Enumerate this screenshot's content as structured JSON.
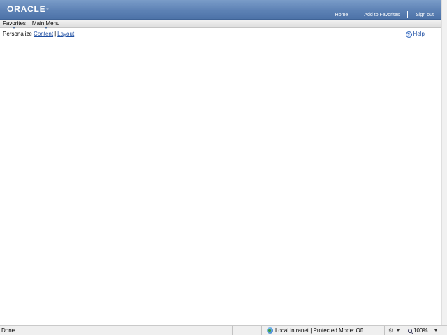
{
  "header": {
    "logo_text": "ORACLE",
    "links": [
      {
        "label": "Home"
      },
      {
        "label": "Add to Favorites"
      },
      {
        "label": "Sign out"
      }
    ]
  },
  "menubar": {
    "items": [
      {
        "label": "Favorites"
      },
      {
        "label": "Main Menu"
      }
    ]
  },
  "personalize": {
    "label": "Personalize",
    "links": [
      {
        "label": "Content"
      },
      {
        "label": "Layout"
      }
    ],
    "separator": "|"
  },
  "help": {
    "label": "Help",
    "icon": "help-icon"
  },
  "statusbar": {
    "status": "Done",
    "zone": "Local intranet | Protected Mode: Off",
    "zoom": "100%"
  },
  "colors": {
    "banner": "#5d82b5",
    "link": "#1f4fa3"
  }
}
